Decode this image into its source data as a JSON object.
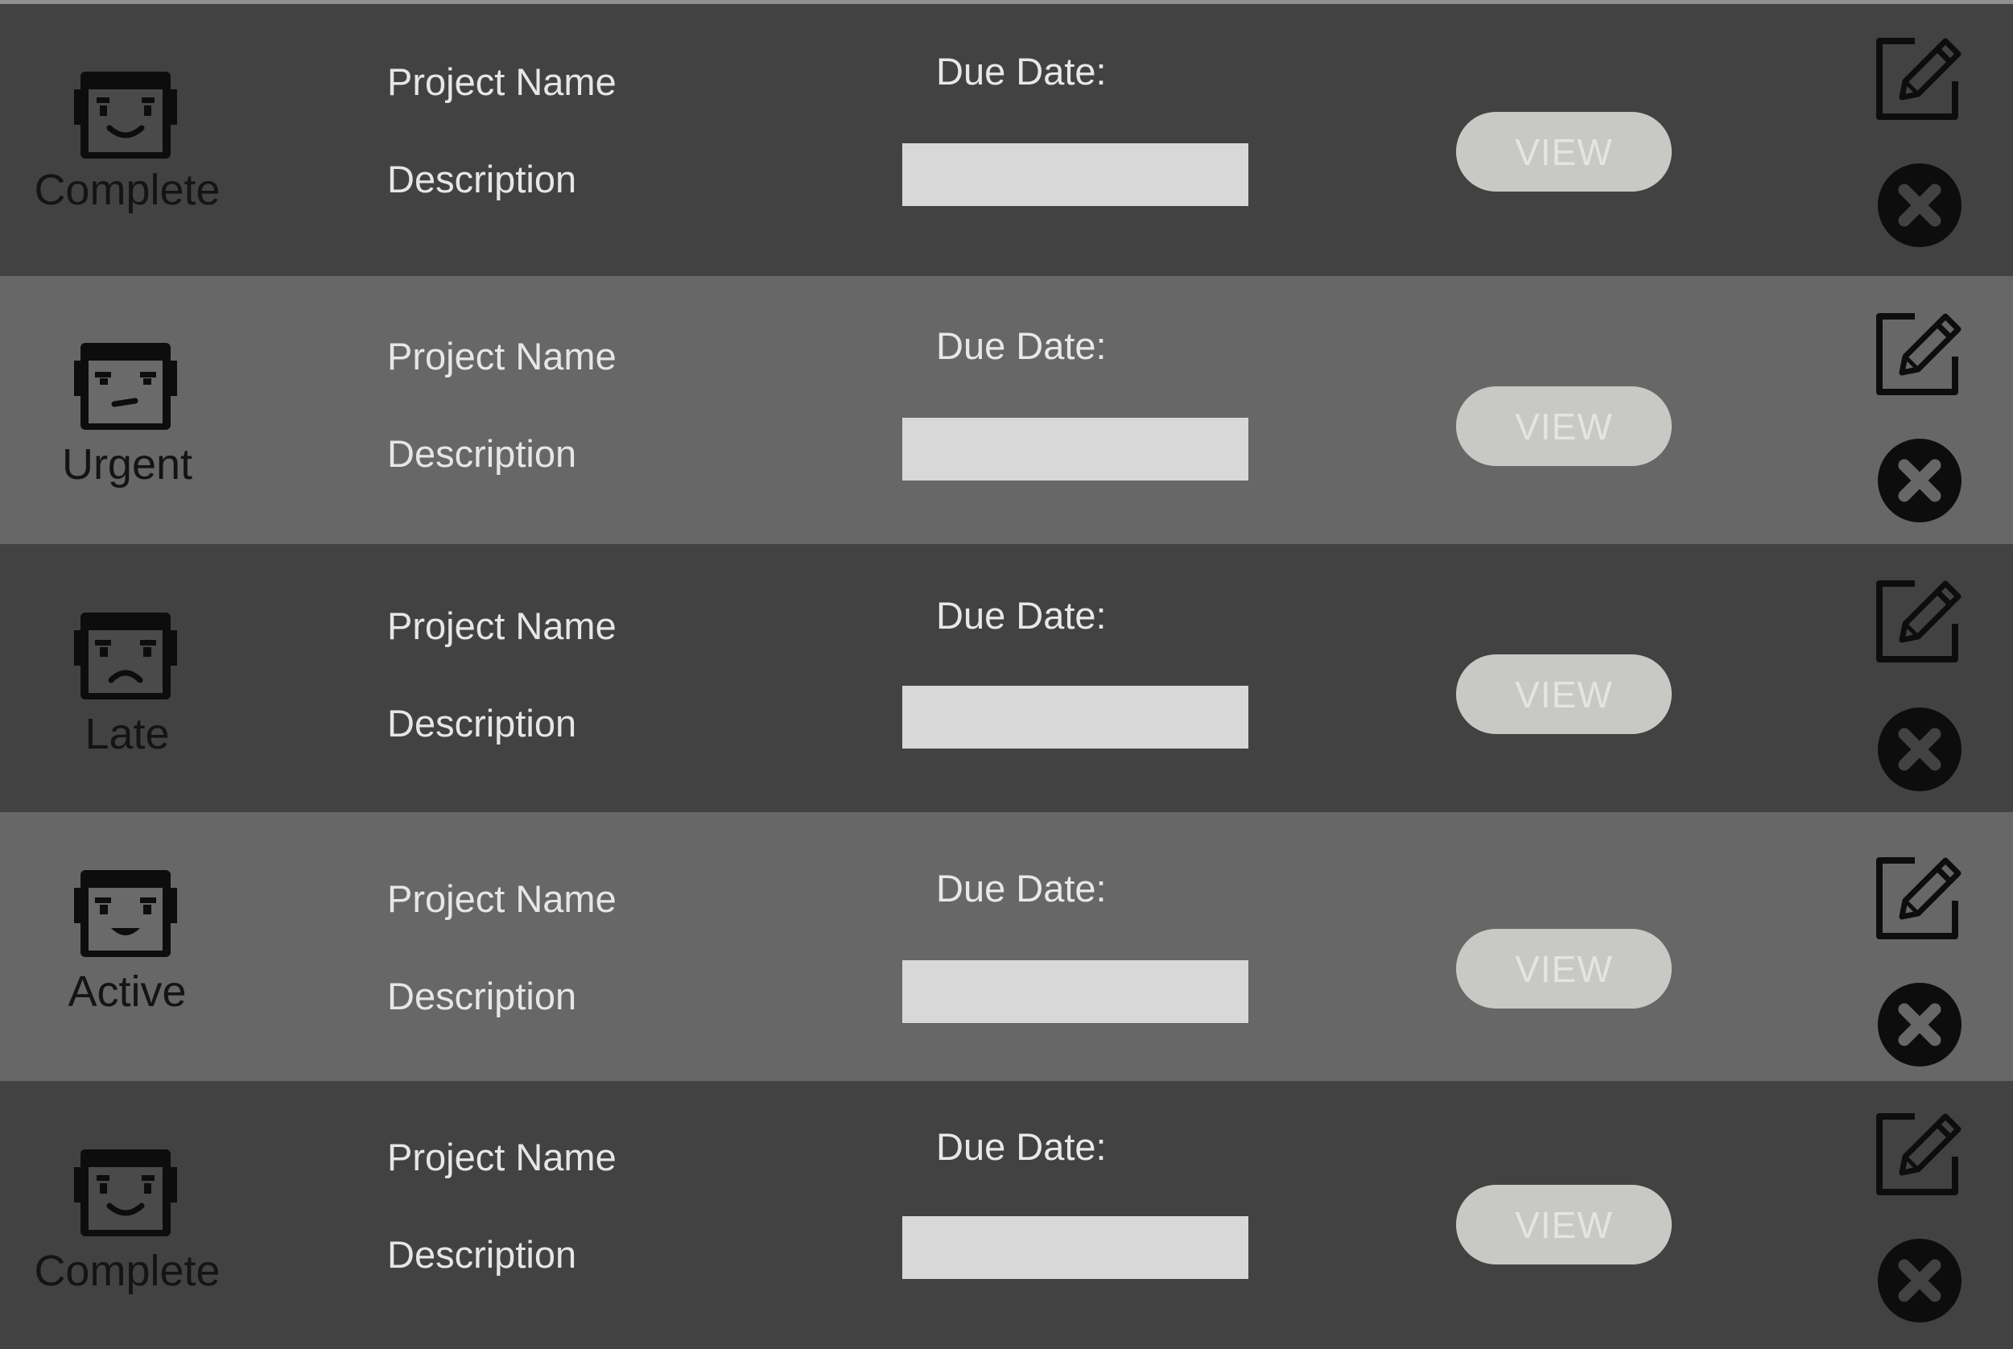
{
  "projects": [
    {
      "status": "Complete",
      "face": "happy-face-icon",
      "name": "Project Name",
      "description": "Description",
      "due_label": "Due Date:",
      "due_value": "",
      "view_label": "VIEW"
    },
    {
      "status": "Urgent",
      "face": "worried-face-icon",
      "name": "Project Name",
      "description": "Description",
      "due_label": "Due Date:",
      "due_value": "",
      "view_label": "VIEW"
    },
    {
      "status": "Late",
      "face": "sad-face-icon",
      "name": "Project Name",
      "description": "Description",
      "due_label": "Due Date:",
      "due_value": "",
      "view_label": "VIEW"
    },
    {
      "status": "Active",
      "face": "smiling-face-icon",
      "name": "Project Name",
      "description": "Description",
      "due_label": "Due Date:",
      "due_value": "",
      "view_label": "VIEW"
    },
    {
      "status": "Complete",
      "face": "happy-face-icon",
      "name": "Project Name",
      "description": "Description",
      "due_label": "Due Date:",
      "due_value": "",
      "view_label": "VIEW"
    }
  ],
  "icons": {
    "edit": "edit-icon",
    "delete": "delete-icon"
  },
  "colors": {
    "row_dark": "#424242",
    "row_light": "#676767",
    "status_text": "#141414",
    "text": "#e6e6e6",
    "due_input": "#d8d8d8",
    "view_button": "#c8c8c4",
    "icon": "#0d0d0d"
  }
}
